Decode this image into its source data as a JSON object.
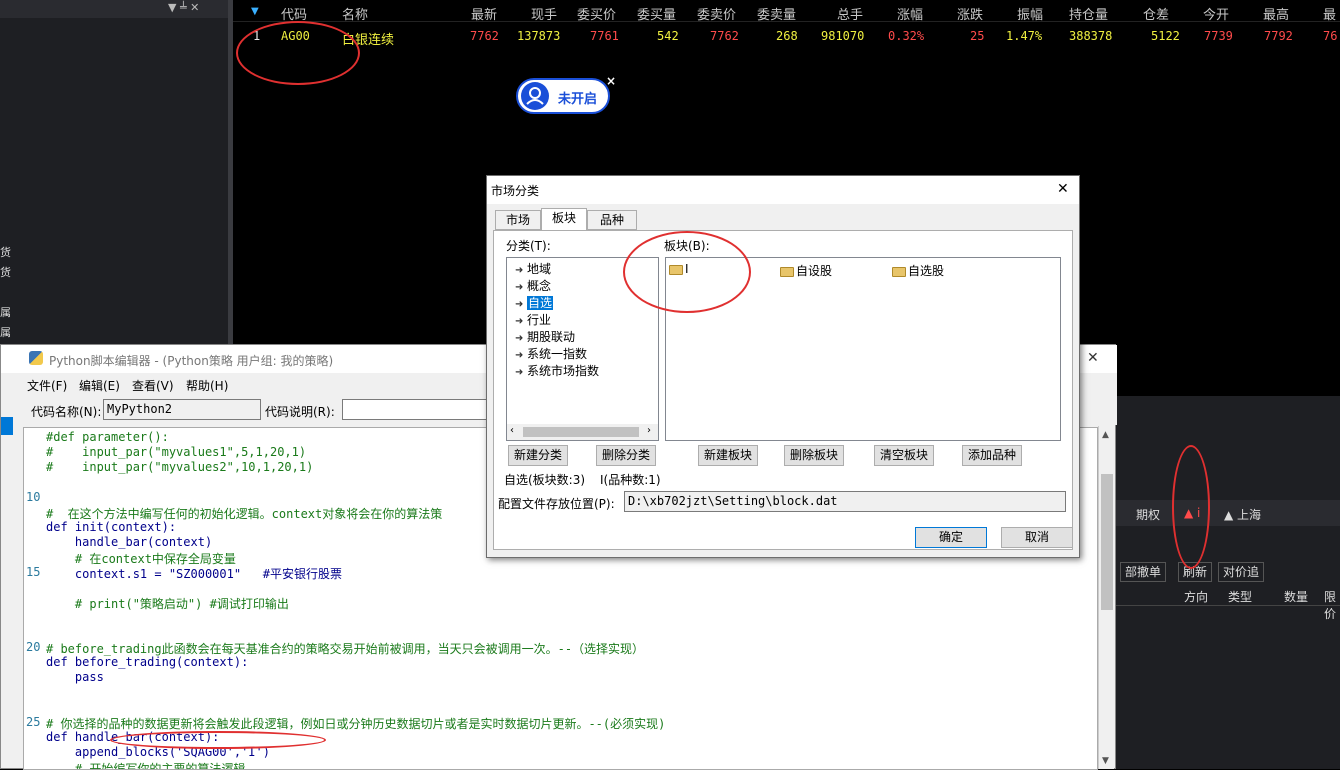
{
  "sidebar": {
    "chars": [
      "货",
      "货",
      "属",
      "属"
    ],
    "ctrl_pin": "▼ ╧ ✕"
  },
  "quote": {
    "headers": [
      "代码",
      "名称",
      "最新",
      "现手",
      "委买价",
      "委买量",
      "委卖价",
      "委卖量",
      "总手",
      "涨幅",
      "涨跌",
      "振幅",
      "持仓量",
      "仓差",
      "今开",
      "最高",
      "最"
    ],
    "row": {
      "idx": "1",
      "code": "AG00",
      "name": "白银连续",
      "last": "7762",
      "vol": "137873",
      "bid": "7761",
      "bidvol": "542",
      "ask": "7762",
      "askvol": "268",
      "total": "981070",
      "chg_pct": "0.32%",
      "chg": "25",
      "amp": "1.47%",
      "oi": "388378",
      "oi_diff": "5122",
      "open": "7739",
      "high": "7792",
      "last_col": "76"
    }
  },
  "badge": {
    "label": "未开启",
    "close": "×"
  },
  "editor": {
    "title": "Python脚本编辑器 - (Python策略 用户组: 我的策略)",
    "menu": [
      "文件(F)",
      "编辑(E)",
      "查看(V)",
      "帮助(H)"
    ],
    "code_name_label": "代码名称(N):",
    "code_name_value": "MyPython2",
    "code_desc_label": "代码说明(R):",
    "code_desc_value": "",
    "close": "✕",
    "lines": [
      {
        "n": "",
        "t": "#def parameter():"
      },
      {
        "n": "",
        "t": "#    input_par(\"myvalues1\",5,1,20,1)"
      },
      {
        "n": "",
        "t": "#    input_par(\"myvalues2\",10,1,20,1)"
      },
      {
        "n": "",
        "t": ""
      },
      {
        "n": "10",
        "t": ""
      },
      {
        "n": "",
        "t": "#  在这个方法中编写任何的初始化逻辑。context对象将会在你的算法策"
      },
      {
        "n": "",
        "t": "def init(context):"
      },
      {
        "n": "",
        "t": "    handle_bar(context)"
      },
      {
        "n": "",
        "t": "    # 在context中保存全局变量"
      },
      {
        "n": "15",
        "t": "    context.s1 = \"SZ000001\"   #平安银行股票"
      },
      {
        "n": "",
        "t": ""
      },
      {
        "n": "",
        "t": "    # print(\"策略启动\") #调试打印输出"
      },
      {
        "n": "",
        "t": ""
      },
      {
        "n": "",
        "t": ""
      },
      {
        "n": "20",
        "t": "# before_trading此函数会在每天基准合约的策略交易开始前被调用，当天只会被调用一次。--（选择实现）"
      },
      {
        "n": "",
        "t": "def before_trading(context):"
      },
      {
        "n": "",
        "t": "    pass"
      },
      {
        "n": "",
        "t": ""
      },
      {
        "n": "",
        "t": ""
      },
      {
        "n": "25",
        "t": "# 你选择的品种的数据更新将会触发此段逻辑，例如日或分钟历史数据切片或者是实时数据切片更新。--(必须实现)"
      },
      {
        "n": "",
        "t": "def handle_bar(context):"
      },
      {
        "n": "",
        "t": "    append_blocks('SQAG00','I')"
      },
      {
        "n": "",
        "t": "    # 开始编写你的主要的算法逻辑。"
      }
    ]
  },
  "right": {
    "tabs": [
      "期权",
      "▲ i",
      "▲ 上海"
    ],
    "buttons": [
      "部撤单",
      "刷新",
      "对价追"
    ],
    "cols": [
      "方向",
      "类型",
      "数量",
      "限价"
    ]
  },
  "dialog": {
    "title": "市场分类",
    "close": "✕",
    "tabs": [
      "市场",
      "板块",
      "品种"
    ],
    "category_label": "分类(T):",
    "block_label": "板块(B):",
    "tree": [
      "地域",
      "概念",
      "自选",
      "行业",
      "期股联动",
      "系统一指数",
      "系统市场指数"
    ],
    "blocks": [
      "I",
      "自设股",
      "自选股"
    ],
    "btn_new_cat": "新建分类",
    "btn_del_cat": "删除分类",
    "btn_new_block": "新建板块",
    "btn_del_block": "删除板块",
    "btn_clear_block": "清空板块",
    "btn_add_item": "添加品种",
    "status_left": "自选(板块数:3)",
    "status_right": "I(品种数:1)",
    "path_label": "配置文件存放位置(P):",
    "path_value": "D:\\xb702jzt\\Setting\\block.dat",
    "ok": "确定",
    "cancel": "取消"
  },
  "colors": {
    "accent": "#0078d7",
    "annotation": "#e03030",
    "quote_red": "#ff4b4b",
    "quote_yellow": "#f0f040"
  }
}
